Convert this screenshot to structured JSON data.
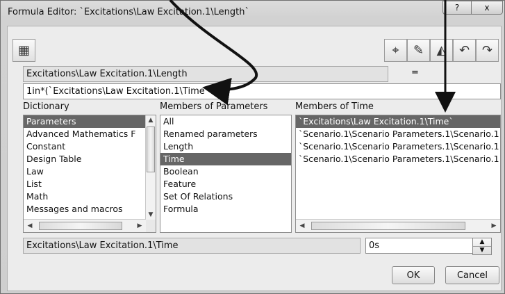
{
  "window": {
    "title": "Formula Editor: `Excitations\\Law Excitation.1\\Length`",
    "help_btn": "?",
    "close_btn": "x"
  },
  "toolbar": {
    "left_icon": "formula-icon",
    "right_icons": [
      "measure-icon",
      "comment-icon",
      "eraser-icon",
      "undo-icon",
      "redo-icon"
    ]
  },
  "parameter": "Excitations\\Law Excitation.1\\Length",
  "equals": "=",
  "formula": "1in*(`Excitations\\Law Excitation.1\\Time`",
  "dictionary": {
    "label": "Dictionary",
    "items": [
      "Parameters",
      "Advanced Mathematics F",
      "Constant",
      "Design Table",
      "Law",
      "List",
      "Math",
      "Messages and macros"
    ],
    "selected": 0
  },
  "members_params": {
    "label": "Members of Parameters",
    "items": [
      "All",
      "Renamed parameters",
      "Length",
      "Time",
      "Boolean",
      "Feature",
      "Set Of Relations",
      "Formula"
    ],
    "selected": 3
  },
  "members_time": {
    "label": "Members of Time",
    "items": [
      "`Excitations\\Law Excitation.1\\Time`",
      "`Scenario.1\\Scenario Parameters.1\\Scenario.1",
      "`Scenario.1\\Scenario Parameters.1\\Scenario.1",
      "`Scenario.1\\Scenario Parameters.1\\Scenario.1"
    ],
    "selected": 0
  },
  "selected_path": "Excitations\\Law Excitation.1\\Time",
  "value": "0s",
  "buttons": {
    "ok": "OK",
    "cancel": "Cancel"
  }
}
